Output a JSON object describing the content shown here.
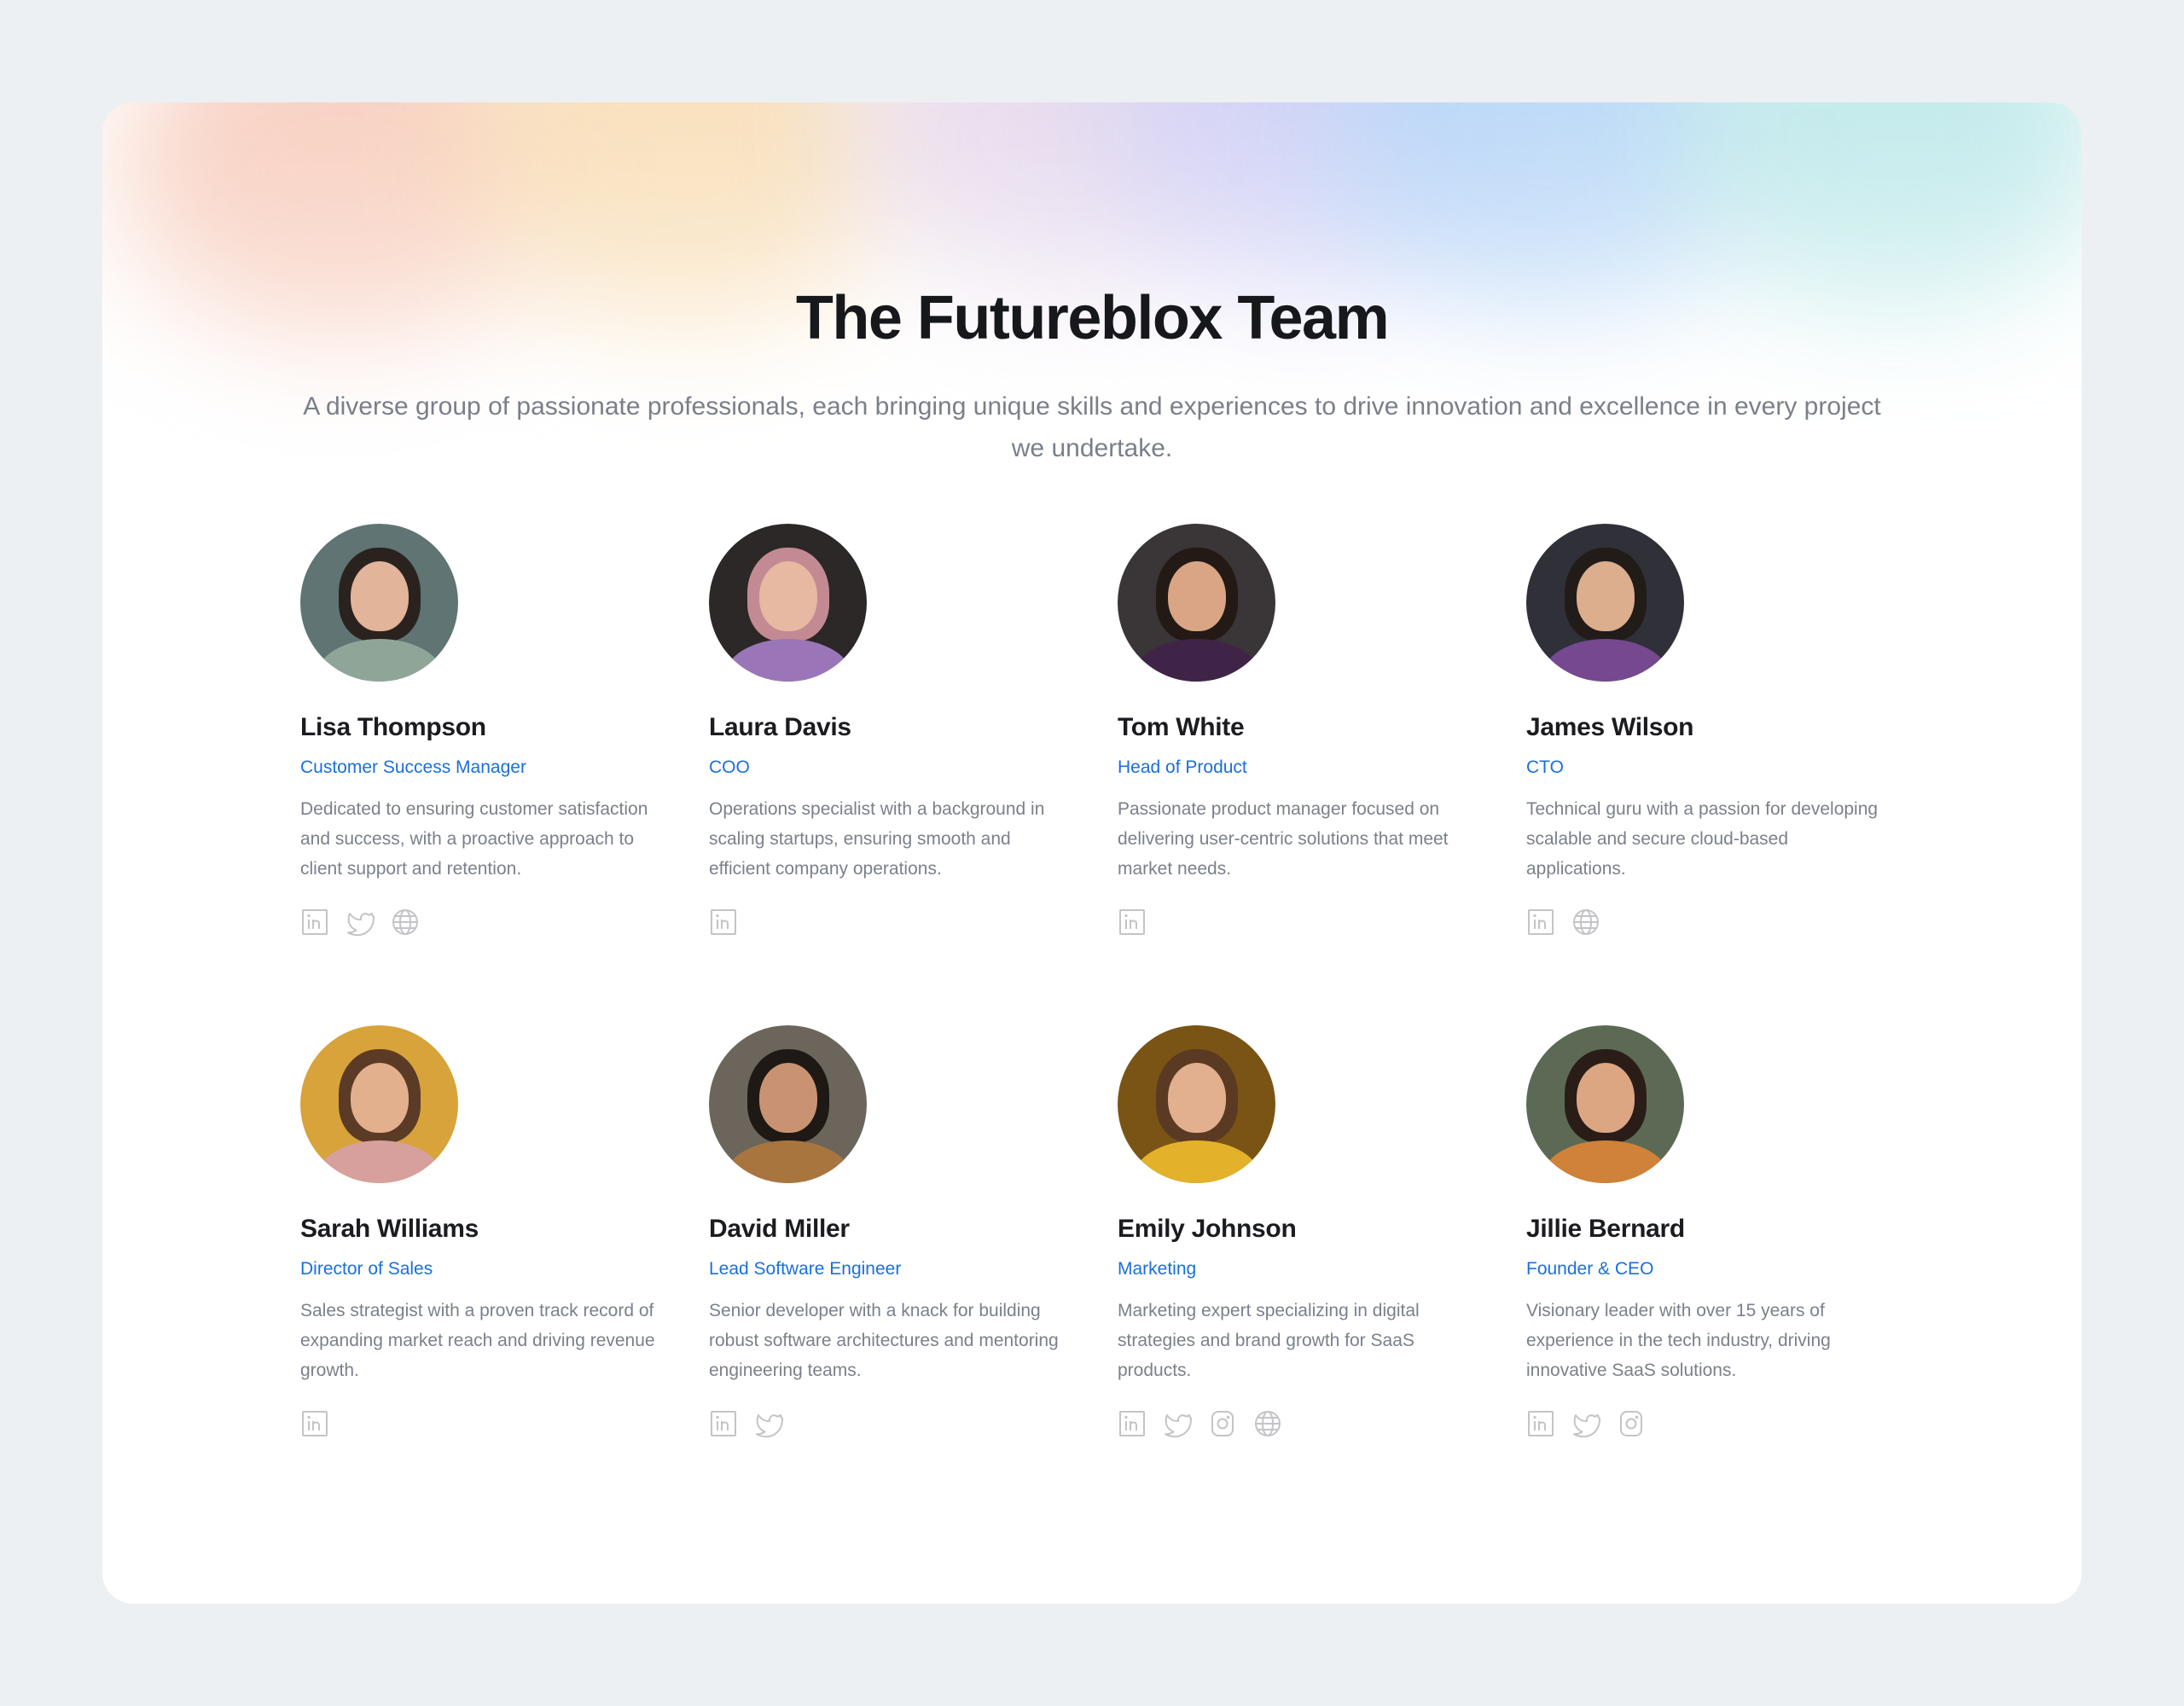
{
  "page": {
    "title": "The Futureblox Team",
    "subtitle": "A diverse group of passionate professionals, each bringing unique skills and experiences to drive innovation and excellence in every project we undertake."
  },
  "colors": {
    "background": "#edf0f3",
    "card": "#ffffff",
    "title": "#17181c",
    "subtitle": "#7a7f8a",
    "role_link": "#1a6fdc",
    "description": "#7b808b",
    "icon": "#c4c4c8"
  },
  "team": [
    {
      "name": "Lisa Thompson",
      "role": "Customer Success Manager",
      "description": "Dedicated to ensuring customer satisfaction and success, with a proactive approach to client support and retention.",
      "avatar": {
        "bg": "#5f7473",
        "skin": "#e2b49a",
        "hair": "#2a221e",
        "top": "#8fa598"
      },
      "socials": [
        "linkedin-icon",
        "twitter-icon",
        "globe-icon"
      ]
    },
    {
      "name": "Laura Davis",
      "role": "COO",
      "description": "Operations specialist with a background in scaling startups, ensuring smooth and efficient company operations.",
      "avatar": {
        "bg": "#2b2827",
        "skin": "#e7b8a2",
        "hair": "#c48a93",
        "top": "#9a76b8"
      },
      "socials": [
        "linkedin-icon"
      ]
    },
    {
      "name": "Tom White",
      "role": "Head of Product",
      "description": "Passionate product manager focused on delivering user-centric solutions that meet market needs.",
      "avatar": {
        "bg": "#3a3536",
        "skin": "#d9a584",
        "hair": "#231a16",
        "top": "#3f2447"
      },
      "socials": [
        "linkedin-icon"
      ]
    },
    {
      "name": "James Wilson",
      "role": "CTO",
      "description": "Technical guru with a passion for developing scalable and secure cloud-based applications.",
      "avatar": {
        "bg": "#2f3038",
        "skin": "#dcae8e",
        "hair": "#221c19",
        "top": "#75488f"
      },
      "socials": [
        "linkedin-icon",
        "globe-icon"
      ]
    },
    {
      "name": "Sarah Williams",
      "role": "Director of Sales",
      "description": "Sales strategist with a proven track record of expanding market reach and driving revenue growth.",
      "avatar": {
        "bg": "#d7a33a",
        "skin": "#e3b08e",
        "hair": "#5b3b25",
        "top": "#d7a09c"
      },
      "socials": [
        "linkedin-icon"
      ]
    },
    {
      "name": "David Miller",
      "role": "Lead Software Engineer",
      "description": "Senior developer with a knack for building robust software architectures and mentoring engineering teams.",
      "avatar": {
        "bg": "#6b655c",
        "skin": "#c99373",
        "hair": "#1f1915",
        "top": "#a9753f"
      },
      "socials": [
        "linkedin-icon",
        "twitter-icon"
      ]
    },
    {
      "name": "Emily Johnson",
      "role": "Marketing",
      "description": "Marketing expert specializing in digital strategies and brand growth for SaaS products.",
      "avatar": {
        "bg": "#7a5415",
        "skin": "#e2b08e",
        "hair": "#5a3a22",
        "top": "#e3b22a"
      },
      "socials": [
        "linkedin-icon",
        "twitter-icon",
        "instagram-icon",
        "globe-icon"
      ]
    },
    {
      "name": "Jillie Bernard",
      "role": "Founder & CEO",
      "description": "Visionary leader with over 15 years of experience in the tech industry, driving innovative SaaS solutions.",
      "avatar": {
        "bg": "#5c6a55",
        "skin": "#dca683",
        "hair": "#2a1d17",
        "top": "#cf8238"
      },
      "socials": [
        "linkedin-icon",
        "twitter-icon",
        "instagram-icon"
      ]
    }
  ]
}
